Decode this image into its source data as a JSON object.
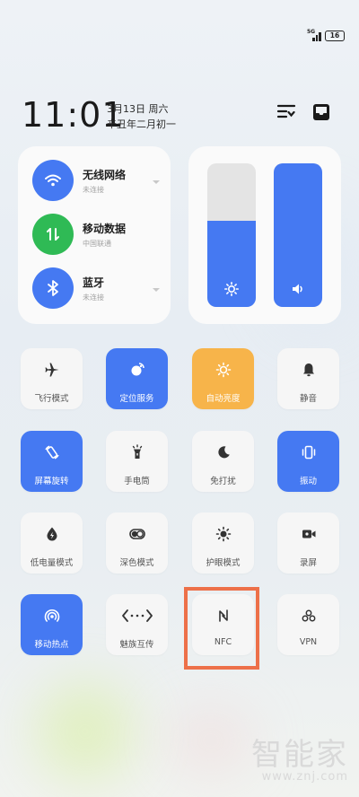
{
  "status_bar": {
    "network": "5G",
    "battery": "16"
  },
  "header": {
    "time": "11:01",
    "date": "3月13日 周六",
    "lunar": "辛丑年二月初一"
  },
  "connectivity": [
    {
      "title": "无线网络",
      "subtitle": "未连接",
      "icon": "wifi-icon",
      "color": "#4579f2"
    },
    {
      "title": "移动数据",
      "subtitle": "中国联通",
      "icon": "mobile-data-icon",
      "color": "#2fba55"
    },
    {
      "title": "蓝牙",
      "subtitle": "未连接",
      "icon": "bluetooth-icon",
      "color": "#4579f2"
    }
  ],
  "sliders": {
    "brightness": 0.6,
    "volume": 1.0
  },
  "tiles": [
    {
      "label": "飞行模式",
      "state": "off"
    },
    {
      "label": "定位服务",
      "state": "on"
    },
    {
      "label": "自动亮度",
      "state": "amber"
    },
    {
      "label": "静音",
      "state": "off"
    },
    {
      "label": "屏幕旋转",
      "state": "on"
    },
    {
      "label": "手电筒",
      "state": "off"
    },
    {
      "label": "免打扰",
      "state": "off"
    },
    {
      "label": "振动",
      "state": "on"
    },
    {
      "label": "低电量模式",
      "state": "off"
    },
    {
      "label": "深色模式",
      "state": "off"
    },
    {
      "label": "护眼模式",
      "state": "off"
    },
    {
      "label": "录屏",
      "state": "off"
    },
    {
      "label": "移动热点",
      "state": "on"
    },
    {
      "label": "魅族互传",
      "state": "off"
    },
    {
      "label": "NFC",
      "state": "off"
    },
    {
      "label": "VPN",
      "state": "off"
    }
  ],
  "colors": {
    "accent": "#4579f2",
    "amber": "#f7b44a",
    "green": "#2fba55",
    "highlight": "#ed7049"
  },
  "watermark": {
    "line1": "智能家",
    "line2": "www.znj.com"
  }
}
